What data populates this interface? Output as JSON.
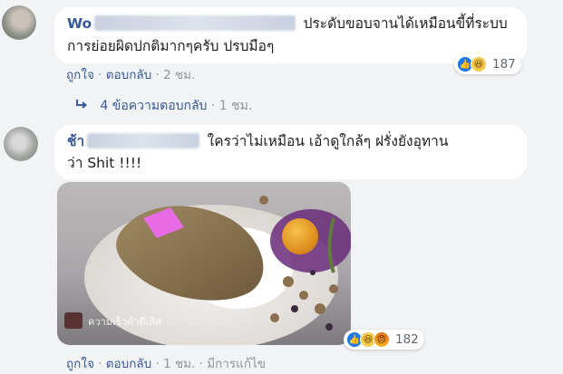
{
  "comments": [
    {
      "author_visible": "Wo",
      "text_line1": "ประดับขอบจานได้เหมือนขี้ที่ระบบ",
      "text_line2": "การย่อยผิดปกติมากๆครับ ปรบมือๆ",
      "actions": {
        "like": "ถูกใจ",
        "reply": "ตอบกลับ",
        "time": "2 ชม."
      },
      "reactions": {
        "types": [
          "like-icon",
          "haha-icon"
        ],
        "count": "187"
      },
      "replies": {
        "label": "4 ข้อความตอบกลับ",
        "time": "1 ชม."
      }
    },
    {
      "author_visible": "ช้า",
      "text_line1": "ใครว่าไม่เหมือน เอ้าดูใกล้ๆ ฝรั่งยังอุทาน",
      "text_line2": "ว่า Shit !!!!",
      "photo_watermark": "ความเร็วคำดีเลิศ",
      "actions": {
        "like": "ถูกใจ",
        "reply": "ตอบกลับ",
        "time": "1 ชม.",
        "edited": "มีการแก้ไข"
      },
      "reactions": {
        "types": [
          "like-icon",
          "haha-icon",
          "angry-icon"
        ],
        "count": "182"
      }
    }
  ],
  "colors": {
    "link": "#385898",
    "name": "#385898",
    "meta": "#90949c",
    "background": "#f2f3f5",
    "like": "#1877f2"
  }
}
